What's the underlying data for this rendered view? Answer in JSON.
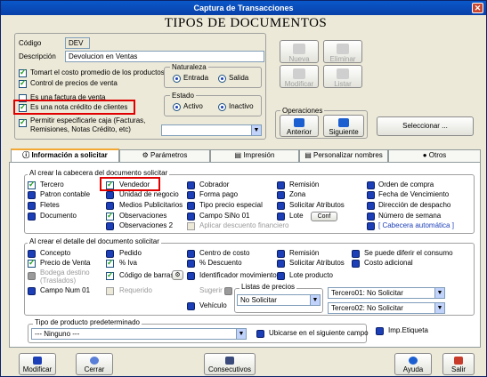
{
  "window": {
    "title": "Captura de Transacciones",
    "close": "✕"
  },
  "heading": "TIPOS DE DOCUMENTOS",
  "codigo": {
    "label": "Código",
    "value": "DEV"
  },
  "descripcion": {
    "label": "Descripción",
    "value": "Devolucion en Ventas"
  },
  "options": {
    "costo_promedio": "Tomart el costo promedio de los productos",
    "control_precios": "Control de precios de venta",
    "factura_venta": "Es una factura de venta",
    "nota_credito": "Es una nota crédito de clientes",
    "permitir_caja": "Permitir especificarle caja (Facturas, Remisiones, Notas Crédito, etc)"
  },
  "naturaleza": {
    "title": "Naturaleza",
    "entrada": "Entrada",
    "salida": "Salida"
  },
  "estado": {
    "title": "Estado",
    "activo": "Activo",
    "inactivo": "Inactivo"
  },
  "buttons": {
    "nueva": "Nueva",
    "eliminar": "Eliminar",
    "modificar": "Modificar",
    "listar": "Listar",
    "anterior": "Anterior",
    "siguiente": "Siguiente",
    "seleccionar": "Seleccionar ..."
  },
  "operaciones": "Operaciones",
  "tabs": [
    "Información a solicitar",
    "Parámetros",
    "Impresión",
    "Personalizar nombres",
    "Otros"
  ],
  "cabecera": {
    "title": "Al crear la cabecera del documento solicitar",
    "col1": [
      "Tercero",
      "Patron contable",
      "Fletes",
      "Documento"
    ],
    "col2": [
      "Vendedor",
      "Unidad de negocio",
      "Medios Publicitarios",
      "Observaciones",
      "Observaciones 2"
    ],
    "col3": [
      "Cobrador",
      "Forma pago",
      "Tipo precio especial",
      "Campo SiNo 01",
      "Aplicar descuento financiero"
    ],
    "col4": [
      "Remisión",
      "Zona",
      "Solicitar Atributos",
      "Lote"
    ],
    "conf": "Conf",
    "col5": [
      "Orden de compra",
      "Fecha de Vencimiento",
      "Dirección de despacho",
      "Número de semana",
      "[ Cabecera automática ]"
    ]
  },
  "detalle": {
    "title": "Al crear  el detalle del documento solicitar",
    "col1": [
      "Concepto",
      "Precio de Venta",
      "Bodega destino (Traslados)",
      "Campo Num 01"
    ],
    "col2": [
      "Pedido",
      "% Iva",
      "Código de barras",
      "Requerido"
    ],
    "col3": [
      "Centro de costo",
      "% Descuento",
      "Identificador movimiento",
      "Sugerir",
      "Vehículo"
    ],
    "col4": [
      "Remisión",
      "Solicitar Atributos",
      "Lote producto"
    ],
    "col5": [
      "Se puede diferir el consumo",
      "Costo adicional"
    ],
    "listas_precios": "Listas de precios",
    "lista_value": "No Solicitar",
    "tercero01": "Tercero01: No Solicitar",
    "tercero02": "Tercero02: No Solicitar"
  },
  "tipo_producto": {
    "title": "Tipo de producto predeterminado",
    "value": "--- Ninguno ---",
    "ubicarse": "Ubicarse en el siguiente campo",
    "imp_etiqueta": "Imp.Etiqueta"
  },
  "bottom": {
    "modificar": "Modificar",
    "cerrar": "Cerrar",
    "consecutivos": "Consecutivos",
    "ayuda": "Ayuda",
    "salir": "Salir"
  }
}
